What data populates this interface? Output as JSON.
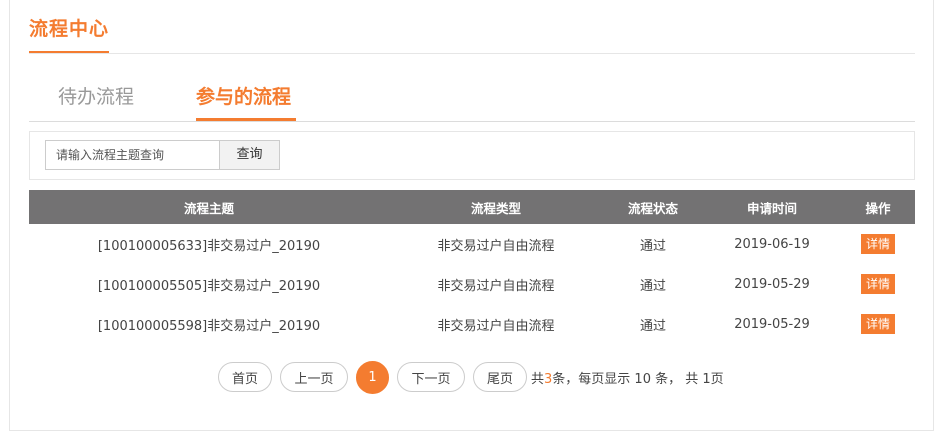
{
  "header": {
    "title": "流程中心"
  },
  "tabs": [
    {
      "label": "待办流程",
      "active": false
    },
    {
      "label": "参与的流程",
      "active": true
    }
  ],
  "search": {
    "placeholder": "请输入流程主题查询",
    "value": "",
    "button_label": "查询"
  },
  "table": {
    "columns": [
      "流程主题",
      "流程类型",
      "流程状态",
      "申请时间",
      "操作"
    ],
    "rows": [
      {
        "subject": "[100100005633]非交易过户_20190",
        "type": "非交易过户自由流程",
        "status": "通过",
        "date": "2019-06-19",
        "action": "详情"
      },
      {
        "subject": "[100100005505]非交易过户_20190",
        "type": "非交易过户自由流程",
        "status": "通过",
        "date": "2019-05-29",
        "action": "详情"
      },
      {
        "subject": "[100100005598]非交易过户_20190",
        "type": "非交易过户自由流程",
        "status": "通过",
        "date": "2019-05-29",
        "action": "详情"
      }
    ]
  },
  "pagination": {
    "first": "首页",
    "prev": "上一页",
    "current": "1",
    "next": "下一页",
    "last": "尾页",
    "summary_prefix": "共",
    "total": "3",
    "summary_suffix": "条，每页显示 10 条， 共 1页"
  },
  "colors": {
    "accent": "#f47c30",
    "table_header": "#737273"
  }
}
